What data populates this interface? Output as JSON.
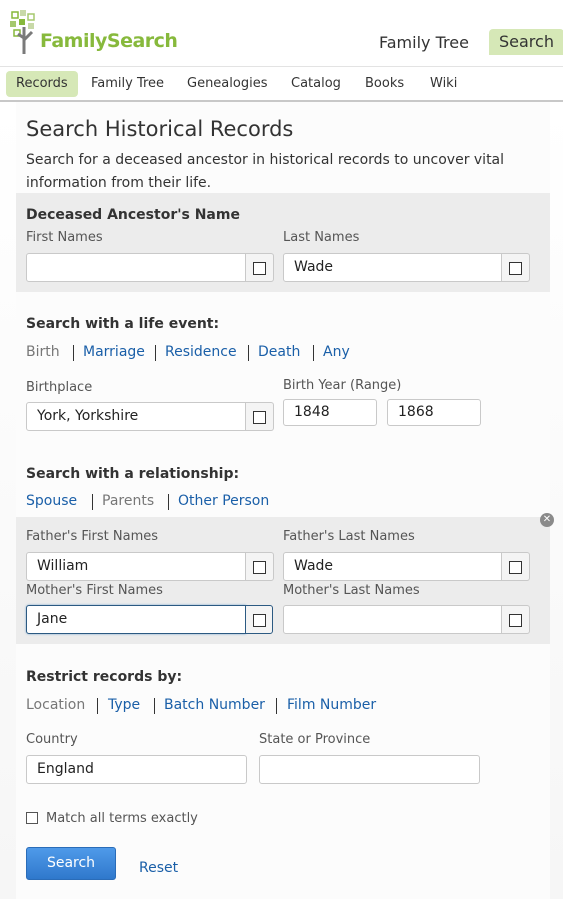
{
  "header": {
    "logo_text": "FamilySearch",
    "nav_family_tree": "Family Tree",
    "nav_search": "Search"
  },
  "subnav": {
    "items": [
      "Records",
      "Family Tree",
      "Genealogies",
      "Catalog",
      "Books",
      "Wiki"
    ],
    "active": "Records"
  },
  "page": {
    "title": "Search Historical Records",
    "description": "Search for a deceased ancestor in historical records to uncover vital information from their life."
  },
  "name_section": {
    "title": "Deceased Ancestor's Name",
    "first_label": "First Names",
    "first_value": "",
    "last_label": "Last Names",
    "last_value": "Wade"
  },
  "life_event": {
    "title": "Search with a life event:",
    "tabs": [
      "Birth",
      "Marriage",
      "Residence",
      "Death",
      "Any"
    ],
    "active_tab": "Birth",
    "place_label": "Birthplace",
    "place_value": "York, Yorkshire",
    "year_label": "Birth Year (Range)",
    "year_from": "1848",
    "year_to": "1868"
  },
  "relationship": {
    "title": "Search with a relationship:",
    "tabs": [
      "Spouse",
      "Parents",
      "Other Person"
    ],
    "active_tab": "Parents",
    "father_first_label": "Father's First Names",
    "father_first_value": "William",
    "father_last_label": "Father's Last Names",
    "father_last_value": "Wade",
    "mother_first_label": "Mother's First Names",
    "mother_first_value": "Jane",
    "mother_last_label": "Mother's Last Names",
    "mother_last_value": "",
    "remove_icon": "close-icon"
  },
  "restrict": {
    "title": "Restrict records by:",
    "tabs": [
      "Location",
      "Type",
      "Batch Number",
      "Film Number"
    ],
    "active_tab": "Location",
    "country_label": "Country",
    "country_value": "England",
    "state_label": "State or Province",
    "state_value": ""
  },
  "options": {
    "match_exact_label": "Match all terms exactly",
    "match_exact_checked": false
  },
  "actions": {
    "search_label": "Search",
    "reset_label": "Reset"
  },
  "colors": {
    "brand_green": "#87b93c",
    "active_tab_bg": "#d6e8b7",
    "link_blue": "#1a5fa8",
    "button_blue": "#3d8be0"
  }
}
